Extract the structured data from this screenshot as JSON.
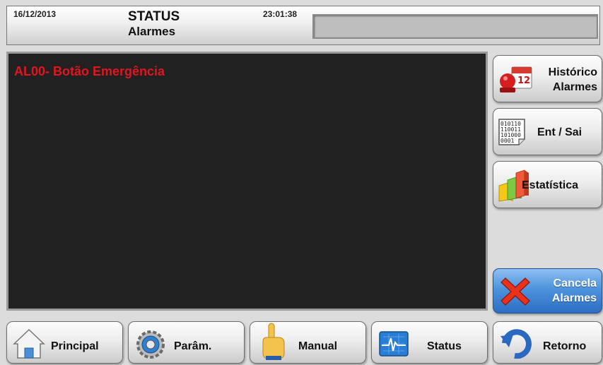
{
  "header": {
    "date": "16/12/2013",
    "title": "STATUS",
    "subtitle": "Alarmes",
    "time": "23:01:38",
    "message": ""
  },
  "alarms": [
    {
      "text": "AL00- Botão Emergência",
      "color": "#e2151f"
    }
  ],
  "side_buttons": {
    "historico": {
      "line1": "Histórico",
      "line2": "Alarmes",
      "icon": "calendar-alarm-icon"
    },
    "ent_sai": {
      "label": "Ent / Sai",
      "icon": "binary-io-icon"
    },
    "estatistica": {
      "label": "Estatística",
      "icon": "bar-chart-3d-icon"
    },
    "cancela": {
      "line1": "Cancela",
      "line2": "Alarmes",
      "icon": "red-x-icon"
    }
  },
  "nav": {
    "principal": {
      "label": "Principal",
      "icon": "home-icon"
    },
    "param": {
      "label": "Parâm.",
      "icon": "gear-icon"
    },
    "manual": {
      "label": "Manual",
      "icon": "hand-pointer-icon"
    },
    "status": {
      "label": "Status",
      "icon": "waveform-monitor-icon"
    },
    "retorno": {
      "label": "Retorno",
      "icon": "back-arrow-icon"
    }
  },
  "colors": {
    "alarm_text": "#e2151f",
    "panel_bg": "#212121",
    "cancel_button": "#2b6ec4"
  }
}
